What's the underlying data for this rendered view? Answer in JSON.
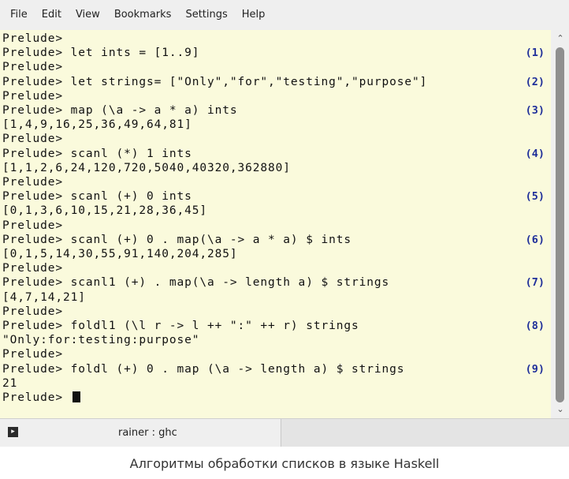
{
  "menu": [
    "File",
    "Edit",
    "View",
    "Bookmarks",
    "Settings",
    "Help"
  ],
  "terminal": {
    "lines": [
      {
        "text": "Prelude>",
        "tag": ""
      },
      {
        "text": "Prelude> let ints = [1..9]",
        "tag": "(1)"
      },
      {
        "text": "Prelude>",
        "tag": ""
      },
      {
        "text": "Prelude> let strings= [\"Only\",\"for\",\"testing\",\"purpose\"]",
        "tag": "(2)"
      },
      {
        "text": "Prelude>",
        "tag": ""
      },
      {
        "text": "Prelude> map (\\a -> a * a) ints",
        "tag": "(3)"
      },
      {
        "text": "[1,4,9,16,25,36,49,64,81]",
        "tag": ""
      },
      {
        "text": "Prelude>",
        "tag": ""
      },
      {
        "text": "Prelude> scanl (*) 1 ints",
        "tag": "(4)"
      },
      {
        "text": "[1,1,2,6,24,120,720,5040,40320,362880]",
        "tag": ""
      },
      {
        "text": "Prelude>",
        "tag": ""
      },
      {
        "text": "Prelude> scanl (+) 0 ints",
        "tag": "(5)"
      },
      {
        "text": "[0,1,3,6,10,15,21,28,36,45]",
        "tag": ""
      },
      {
        "text": "Prelude>",
        "tag": ""
      },
      {
        "text": "Prelude> scanl (+) 0 . map(\\a -> a * a) $ ints",
        "tag": "(6)"
      },
      {
        "text": "[0,1,5,14,30,55,91,140,204,285]",
        "tag": ""
      },
      {
        "text": "Prelude>",
        "tag": ""
      },
      {
        "text": "Prelude> scanl1 (+) . map(\\a -> length a) $ strings",
        "tag": "(7)"
      },
      {
        "text": "[4,7,14,21]",
        "tag": ""
      },
      {
        "text": "Prelude>",
        "tag": ""
      },
      {
        "text": "Prelude> foldl1 (\\l r -> l ++ \":\" ++ r) strings",
        "tag": "(8)"
      },
      {
        "text": "\"Only:for:testing:purpose\"",
        "tag": ""
      },
      {
        "text": "Prelude>",
        "tag": ""
      },
      {
        "text": "Prelude> foldl (+) 0 . map (\\a -> length a) $ strings",
        "tag": "(9)"
      },
      {
        "text": "21",
        "tag": ""
      },
      {
        "text": "Prelude> ",
        "tag": "",
        "cursor": true
      }
    ]
  },
  "tab": {
    "label": "rainer : ghc"
  },
  "caption": "Алгоритмы обработки списков в языке Haskell"
}
